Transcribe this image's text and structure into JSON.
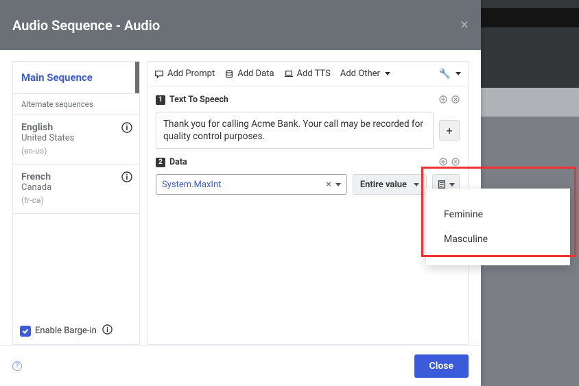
{
  "header": {
    "title": "Audio Sequence - Audio"
  },
  "sidebar": {
    "main_sequence": "Main Sequence",
    "alt_label": "Alternate sequences",
    "langs": [
      {
        "name": "English",
        "region": "United States",
        "locale": "(en-us)"
      },
      {
        "name": "French",
        "region": "Canada",
        "locale": "(fr-ca)"
      }
    ],
    "barge_label": "Enable Barge-in",
    "barge_checked": true
  },
  "toolbar": {
    "add_prompt": "Add Prompt",
    "add_data": "Add Data",
    "add_tts": "Add TTS",
    "add_other": "Add Other"
  },
  "steps": [
    {
      "num": "1",
      "title": "Text To Speech",
      "tts_value": "Thank you for calling Acme Bank. Your call may be recorded for quality control purposes."
    },
    {
      "num": "2",
      "title": "Data",
      "data_value": "System.MaxInt",
      "entire_label": "Entire value"
    }
  ],
  "dropdown": {
    "items": [
      "Feminine",
      "Masculine"
    ]
  },
  "footer": {
    "close": "Close"
  }
}
